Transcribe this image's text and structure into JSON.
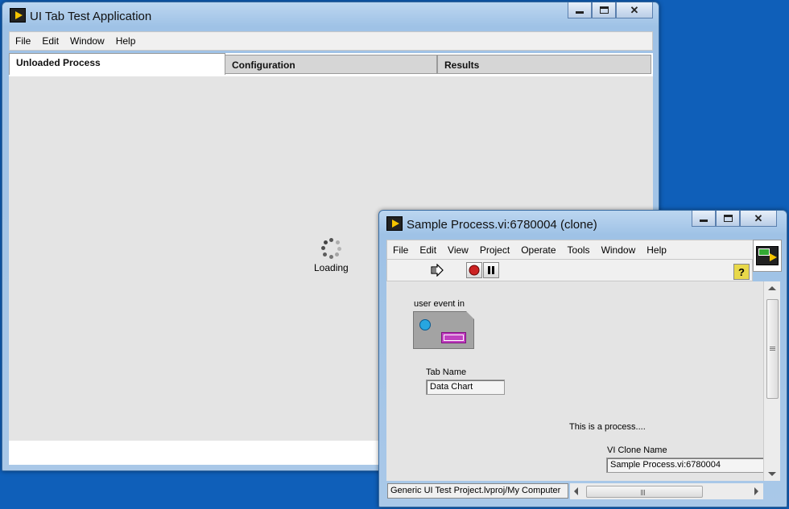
{
  "main_window": {
    "title": "UI Tab Test Application",
    "menu": [
      "File",
      "Edit",
      "Window",
      "Help"
    ],
    "tabs": [
      "Unloaded Process",
      "Configuration",
      "Results"
    ],
    "active_tab": "Unloaded Process",
    "loading_text": "Loading"
  },
  "sub_window": {
    "title": "Sample Process.vi:6780004 (clone)",
    "menu": [
      "File",
      "Edit",
      "View",
      "Project",
      "Operate",
      "Tools",
      "Window",
      "Help"
    ],
    "user_event_label": "user event in",
    "tab_name_label": "Tab Name",
    "tab_name_value": "Data Chart",
    "process_text": "This is a process....",
    "clone_name_label": "VI Clone Name",
    "clone_name_value": "Sample Process.vi:6780004",
    "status_path": "Generic UI Test Project.lvproj/My Computer",
    "help_glyph": "?"
  },
  "colors": {
    "desktop": "#0f5fb9",
    "panel": "#e4e4e4",
    "stop_button": "#cc2222",
    "help_button": "#e8d84a",
    "event_terminal": "#c040c0"
  }
}
